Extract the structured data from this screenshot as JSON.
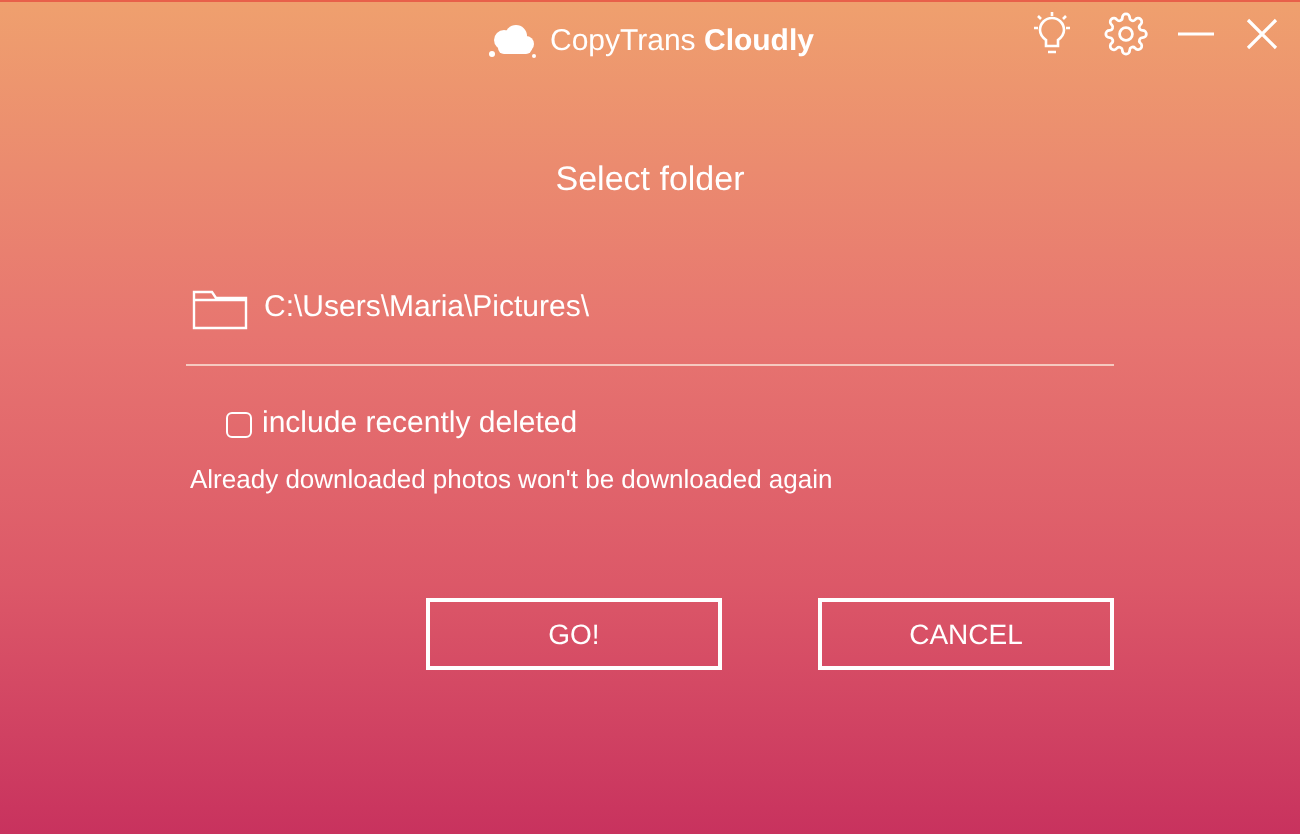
{
  "app_title": "CopyTrans **Cloudly**",
  "heading": "Select folder",
  "folder": {
    "path": "C:\\Users\\Maria\\Pictures\\"
  },
  "option": {
    "label": "include recently deleted",
    "checked": false
  },
  "note": "Already downloaded photos won't be downloaded again",
  "buttons": [
    {
      "label": "GO!"
    },
    {
      "label": "CANCEL"
    }
  ]
}
